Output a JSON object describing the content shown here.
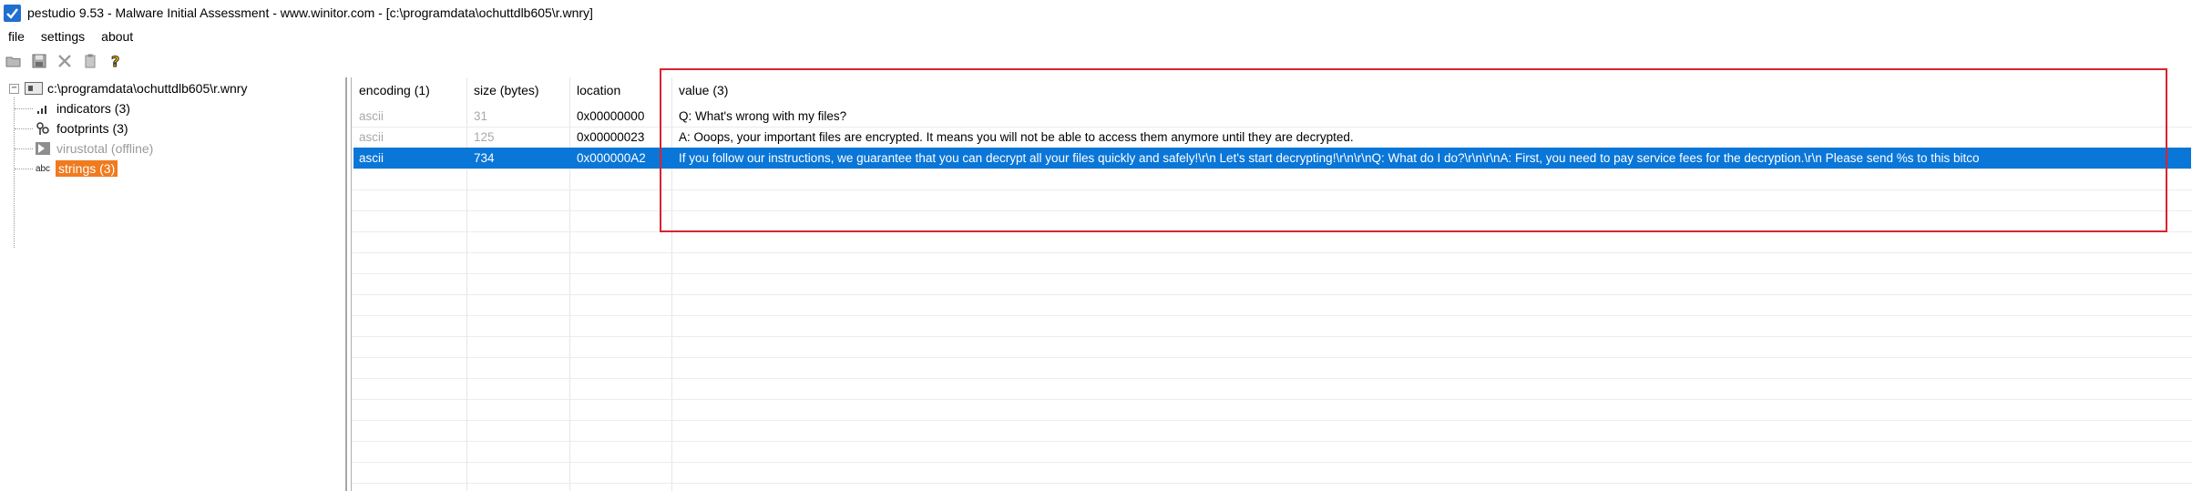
{
  "window": {
    "title": "pestudio 9.53 - Malware Initial Assessment - www.winitor.com - [c:\\programdata\\ochuttdlb605\\r.wnry]"
  },
  "menu": {
    "items": [
      "file",
      "settings",
      "about"
    ]
  },
  "toolbar": {
    "icons": [
      "open-folder-icon",
      "save-icon",
      "close-icon",
      "clipboard-icon",
      "help-icon"
    ]
  },
  "tree": {
    "root_label": "c:\\programdata\\ochuttdlb605\\r.wnry",
    "items": [
      {
        "label": "indicators (3)",
        "icon": "indicators-icon",
        "state": "normal"
      },
      {
        "label": "footprints (3)",
        "icon": "footprints-icon",
        "state": "normal"
      },
      {
        "label": "virustotal (offline)",
        "icon": "virustotal-icon",
        "state": "disabled"
      },
      {
        "label": "strings (3)",
        "icon": "strings-icon",
        "icon_text": "abc",
        "state": "selected"
      }
    ]
  },
  "grid": {
    "columns": [
      "encoding (1)",
      "size (bytes)",
      "location",
      "value (3)"
    ],
    "rows": [
      {
        "encoding": "ascii",
        "size": "31",
        "location": "0x00000000",
        "value": "Q:  What's wrong with my files?"
      },
      {
        "encoding": "ascii",
        "size": "125",
        "location": "0x00000023",
        "value": "A:  Ooops, your important files are encrypted. It means you will not be able to access them anymore until they are decrypted."
      },
      {
        "encoding": "ascii",
        "size": "734",
        "location": "0x000000A2",
        "value": "If you follow our instructions, we guarantee that you can decrypt all your files quickly and safely!\\r\\n    Let's start decrypting!\\r\\n\\r\\nQ:  What do I do?\\r\\n\\r\\nA:  First, you need to pay service fees for the decryption.\\r\\n    Please send %s to this bitco"
      }
    ],
    "selected_row": 2
  },
  "colors": {
    "selection": "#0a76d8",
    "tree_selected": "#f07a1e",
    "highlight_border": "#d9232f"
  }
}
